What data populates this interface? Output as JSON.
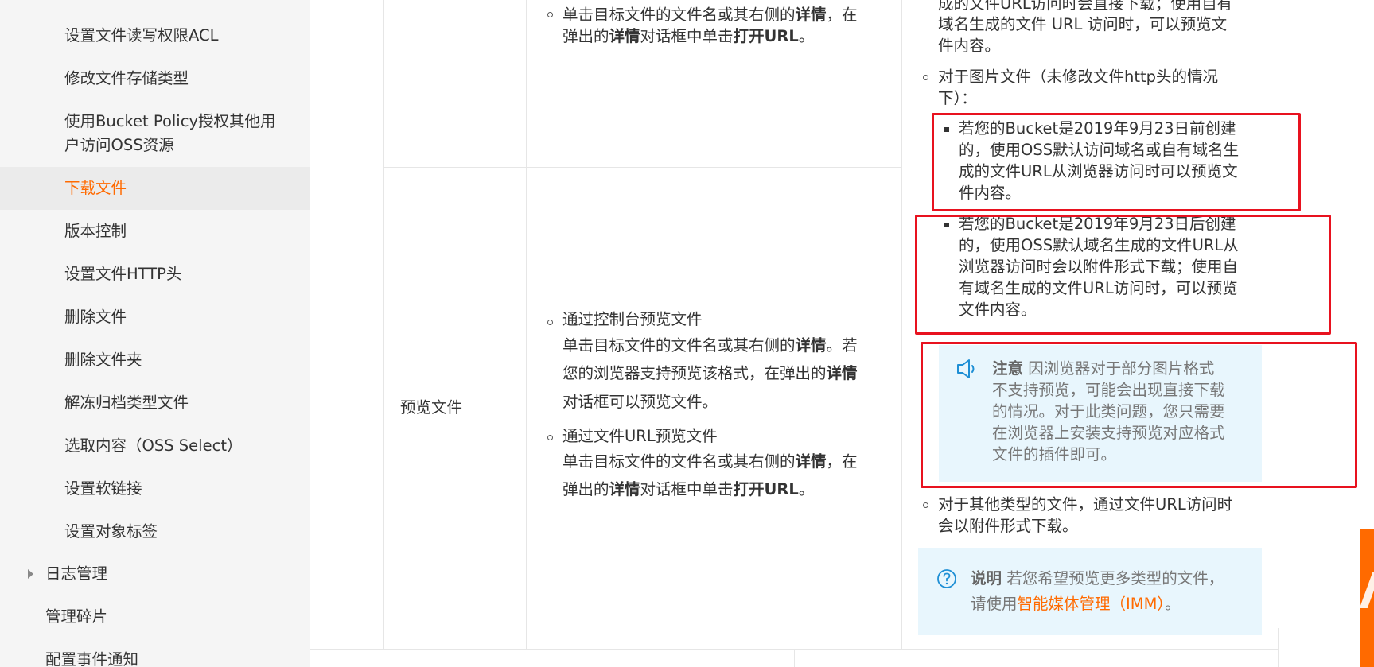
{
  "sidebar": {
    "items": [
      {
        "label": "设置文件读写权限ACL"
      },
      {
        "label": "修改文件存储类型"
      },
      {
        "label": "使用Bucket Policy授权其他用户访问OSS资源"
      },
      {
        "label": "下载文件"
      },
      {
        "label": "版本控制"
      },
      {
        "label": "设置文件HTTP头"
      },
      {
        "label": "删除文件"
      },
      {
        "label": "删除文件夹"
      },
      {
        "label": "解冻归档类型文件"
      },
      {
        "label": "选取内容（OSS Select）"
      },
      {
        "label": "设置软链接"
      },
      {
        "label": "设置对象标签"
      }
    ],
    "top_sliver": "…",
    "level1": [
      {
        "label": "日志管理"
      },
      {
        "label": "管理碎片"
      },
      {
        "label": "配置事件通知"
      }
    ]
  },
  "table": {
    "row_top": {
      "col2_line1_a": "单击目标文件的文件名或其右侧的",
      "col2_line1_b": "详情",
      "col2_line1_c": "，在",
      "col2_line2_a": "弹出的",
      "col2_line2_b": "详情",
      "col2_line2_c": "对话框中单击",
      "col2_line2_d": "打开URL",
      "col2_line2_e": "。",
      "col3_line0": "成的文件URL访问时会直接下载；使用自有",
      "col3_line1": "域名生成的文件 URL 访问时，可以预览文",
      "col3_line2": "件内容。"
    },
    "row_preview": {
      "feature": "预览文件",
      "method1_title": "通过控制台预览文件",
      "method1_l1_a": "单击目标文件的文件名或其右侧的",
      "method1_l1_b": "详情",
      "method1_l1_c": "。若",
      "method1_l2_a": "您的浏览器支持预览该格式，在弹出的",
      "method1_l2_b": "详情",
      "method1_l3": "对话框可以预览文件。",
      "method2_title": "通过文件URL预览文件",
      "method2_l1_a": "单击目标文件的文件名或其右侧的",
      "method2_l1_b": "详情",
      "method2_l1_c": "，在",
      "method2_l2_a": "弹出的",
      "method2_l2_b": "详情",
      "method2_l2_c": "对话框中单击",
      "method2_l2_d": "打开URL",
      "method2_l2_e": "。",
      "img_line1": "对于图片文件（未修改文件http头的情况",
      "img_line2": "下）：",
      "sub1_l1": "若您的Bucket是2019年9月23日前创建",
      "sub1_l2": "的，使用OSS默认访问域名或自有域名生",
      "sub1_l3": "成的文件URL从浏览器访问时可以预览文",
      "sub1_l4": "件内容。",
      "sub2_l1": "若您的Bucket是2019年9月23日后创建",
      "sub2_l2": "的，使用OSS默认域名生成的文件URL从",
      "sub2_l3": "浏览器访问时会以附件形式下载；使用自",
      "sub2_l4": "有域名生成的文件URL访问时，可以预览",
      "sub2_l5": "文件内容。",
      "note_label": "注意",
      "note_l1": "因浏览器对于部分图片格式",
      "note_l2": "不支持预览，可能会出现直接下载",
      "note_l3": "的情况。对于此类问题，您只需要",
      "note_l4": "在浏览器上安装支持预览对应格式",
      "note_l5": "文件的插件即可。",
      "other_l1": "对于其他类型的文件，通过文件URL访问时",
      "other_l2": "会以附件形式下载。",
      "info_label": "说明",
      "info_l1": "若您希望预览更多类型的文件，",
      "info_l2_a": "请使用",
      "info_l2_link": "智能媒体管理（IMM）",
      "info_l2_b": "。"
    }
  },
  "colors": {
    "accent": "#ff6a00",
    "highlight_box": "#e8121f",
    "tip_bg": "#e8f6fd",
    "sidebar_bg": "#f5f5f5"
  },
  "icons": {
    "note": "speaker-icon",
    "info": "question-circle-icon"
  }
}
